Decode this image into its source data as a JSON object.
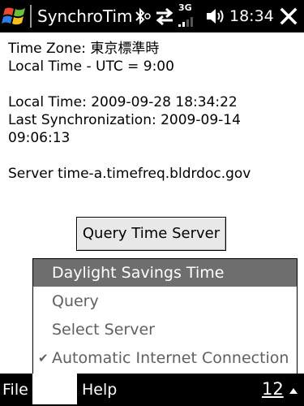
{
  "titlebar": {
    "app_title": "SynchroTim",
    "clock": "18:34",
    "icons": [
      "windows-start-icon",
      "bluetooth-icon",
      "data-transfer-icon",
      "3g-signal-icon",
      "volume-icon",
      "close-icon"
    ],
    "network_label": "3G"
  },
  "content": {
    "time_zone": "Time Zone: 東京標準時",
    "local_time_offset": "Local Time - UTC = 9:00",
    "local_time": "Local Time: 2009-09-28 18:34:22",
    "last_sync_label": "Last Synchronization: 2009-09-14",
    "last_sync_time": "09:06:13",
    "server": "Server time-a.timefreq.bldrdoc.gov"
  },
  "query_button_label": "Query Time Server",
  "menu": {
    "items": [
      {
        "label": "Daylight Savings Time",
        "selected": true,
        "checked": false
      },
      {
        "label": "Query",
        "selected": false,
        "checked": false
      },
      {
        "label": "Select Server",
        "selected": false,
        "checked": false
      },
      {
        "label": "Automatic Internet Connection",
        "selected": false,
        "checked": true
      }
    ]
  },
  "softkeys": {
    "left": "File",
    "right": "Help",
    "page_number": "12",
    "arrow_icon": "up-arrow-icon"
  },
  "colors": {
    "bar_background": "#000000",
    "menu_highlight": "#6e6e6e",
    "menu_text": "#606060"
  }
}
